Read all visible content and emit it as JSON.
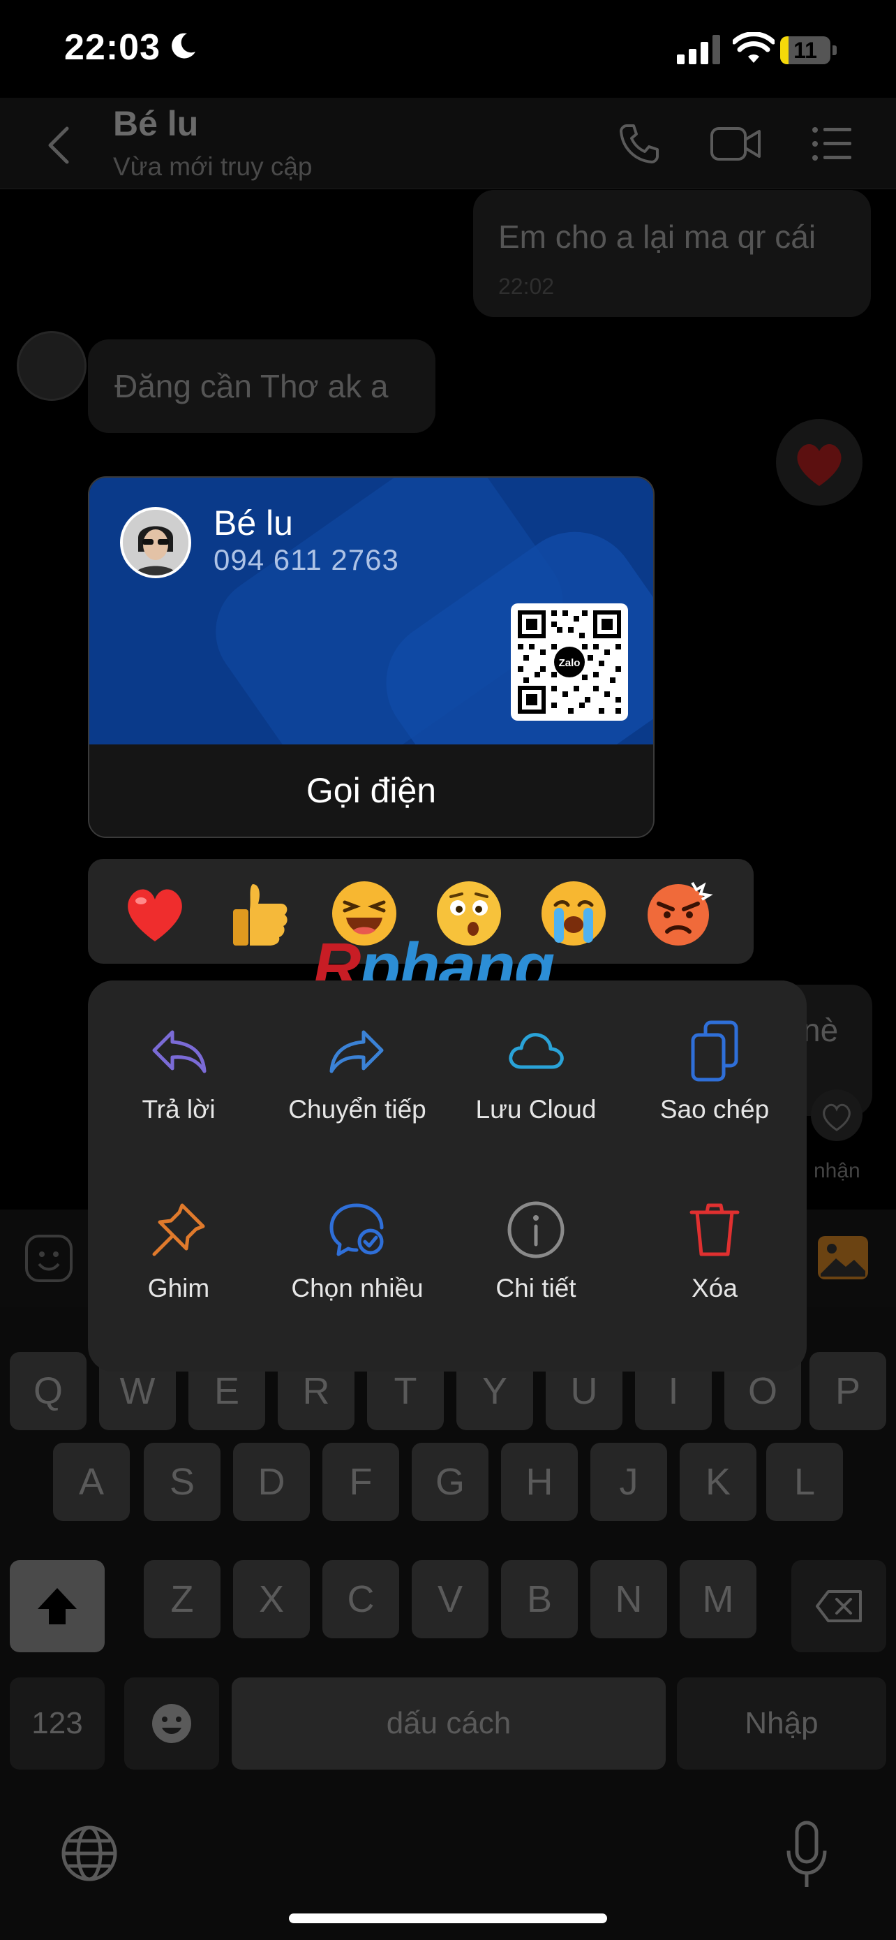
{
  "status_bar": {
    "time": "22:03",
    "battery": "11"
  },
  "header": {
    "name": "Bé lu",
    "subtitle": "Vừa mới truy cập"
  },
  "messages": [
    {
      "text": "Em cho a lại ma qr cái",
      "time": "22:02"
    },
    {
      "text": "Đăng cần Thơ ak a"
    },
    {
      "text": "nè"
    }
  ],
  "received_label": "nhận",
  "card": {
    "name": "Bé lu",
    "phone": "094 611 2763",
    "qr_logo": "Zalo",
    "call_label": "Gọi điện"
  },
  "reactions": [
    "❤️",
    "👍",
    "😆",
    "😲",
    "😭",
    "😡"
  ],
  "watermark": {
    "first": "R",
    "rest": "phang"
  },
  "actions": [
    {
      "label": "Trả lời",
      "icon": "reply-icon",
      "color": "#7b6bd6"
    },
    {
      "label": "Chuyển tiếp",
      "icon": "forward-icon",
      "color": "#3b82d6"
    },
    {
      "label": "Lưu Cloud",
      "icon": "cloud-icon",
      "color": "#2aa3d8"
    },
    {
      "label": "Sao chép",
      "icon": "copy-icon",
      "color": "#2f6fd8"
    },
    {
      "label": "Ghim",
      "icon": "pin-icon",
      "color": "#e07a2c"
    },
    {
      "label": "Chọn nhiều",
      "icon": "multi-select-icon",
      "color": "#2f6fd8"
    },
    {
      "label": "Chi tiết",
      "icon": "info-icon",
      "color": "#8a8a8a"
    },
    {
      "label": "Xóa",
      "icon": "trash-icon",
      "color": "#e03030"
    }
  ],
  "keyboard": {
    "row1": [
      "Q",
      "W",
      "E",
      "R",
      "T",
      "Y",
      "U",
      "I",
      "O",
      "P"
    ],
    "row2": [
      "A",
      "S",
      "D",
      "F",
      "G",
      "H",
      "J",
      "K",
      "L"
    ],
    "row3": [
      "Z",
      "X",
      "C",
      "V",
      "B",
      "N",
      "M"
    ],
    "numbers": "123",
    "space": "dấu cách",
    "enter": "Nhập"
  }
}
